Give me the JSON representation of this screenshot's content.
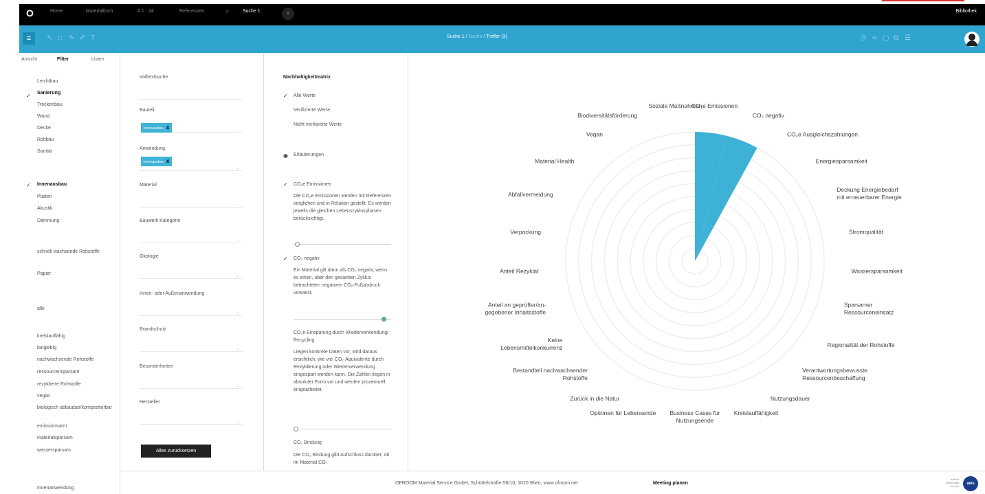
{
  "topbar": {
    "logo": "O",
    "tabs": [
      "Home",
      "Materialtisch",
      "# 1 - 24",
      "Referenzen",
      "Suche 1"
    ],
    "library": "Bibliothek",
    "close": "×",
    "search_icon": "search-icon"
  },
  "toolbar": {
    "menu": "≡",
    "crumb_a": "Suche 1 / ",
    "crumb_b": "Suche",
    "crumb_c": " / Treffer (3)"
  },
  "filter": {
    "segments": [
      "Ansicht",
      "Filter",
      "Listen"
    ],
    "groups": [
      "Leichtbau",
      "Sanierung",
      "Trockenbau",
      "Wand",
      "Decke",
      "Rohbau",
      "Sanitär",
      "Innenausbau",
      "Platten",
      "Akustik",
      "Dämmung",
      "schnell wachsende Rohstoffe",
      "Papier",
      "alle",
      "kreislauffähig",
      "langlebig",
      "nachwachsende Rohstoffe",
      "ressourcensparsam",
      "rezyklierte Rohstoffe",
      "vegan",
      "biologisch abbaubar/kompostierbar",
      "emissionsarm",
      "materialsparsam",
      "wassersparsam",
      "Innenanwendung"
    ]
  },
  "search": {
    "fields": [
      "Volltextsuche",
      "Bauteil",
      "Anwendung",
      "Material",
      "Bauwerk Kategorie",
      "Ökologie",
      "Innen- oder Außenanwendung",
      "Brandschutz",
      "Besonderheiten",
      "Hersteller"
    ],
    "chip_bauteil": "Innenausbau",
    "chip_anwendung": "Innenausbau",
    "chip_x": "x",
    "reset": "Alles zurücksetzen"
  },
  "matrix": {
    "title": "Nachhaltigkeitmatrix",
    "opt1": "Alle Werte",
    "opt2": "Verifizierte Werte",
    "opt3": "Nicht verifizierte Werte",
    "opt4": "Erläuterungen",
    "s1_title": "CO₂e Emissionen",
    "s1_desc": "Die CO₂e Emissionen werden mit Referenzen verglichen und in Relation gestellt. Es werden jeweils die gleichen Lebenszyklusphasen berücksichtigt.",
    "s2_title": "CO₂ negativ",
    "s2_desc": "Ein Material gilt dann als CO₂ negativ, wenn es einen, über den gesamten Zyklus betrachteten negativen CO₂-Fußabdruck vorweist.",
    "s3_title": "CO₂e Einsparung durch Wiederverwendung/ Recycling",
    "s3_desc": "Liegen konkrete Daten vor, wird daraus ersichtlich, wie viel CO₂ Äquivalente durch Rezyklierung oder Wiederverwendung eingespart werden kann. Die Zahlen liegen in absoluter Form vor und werden prozentuell eingearbeitet.",
    "s4_title": "CO₂ Bindung",
    "s4_desc": "Die CO₂ Bindung gibt Aufschluss darüber, ob im Material CO₂"
  },
  "chart_data": {
    "type": "radar",
    "rings": 10,
    "highlight_color": "#3eb1d6",
    "categories": [
      "CO₂e Emissionen",
      "CO₂ negativ",
      "CO₂e Ausgleichszahlungen",
      "Energiesparsamkeit",
      "Deckung Energiebedarf mit erneuerbarer Energie",
      "Stromqualität",
      "Wassersparsamkeit",
      "Sparsamer Ressourceneinsatz",
      "Regionalität der Rohstoffe",
      "Verantwortungsbewusste Ressourcenbeschaffung",
      "Nutzungsdauer",
      "Kreislauffähigkeit",
      "Business Cases für Nutzungsende",
      "Optionen für Lebensende",
      "Zurück in die Natur",
      "Bestandteil nachwachsender Rohstoffe",
      "Keine Lebensmittelkonkurrenz",
      "Anteil an geprüfter/an-gegebener Inhaltsstoffe",
      "Anteil Rezyklat",
      "Verpackung",
      "Abfallvermeidung",
      "Material Health",
      "Vegan",
      "Biodiversitätsförderung",
      "Soziale Maßnahmen"
    ],
    "values": [
      10,
      10,
      0,
      0,
      0,
      0,
      0,
      0,
      0,
      0,
      0,
      0,
      0,
      0,
      0,
      0,
      0,
      0,
      0,
      0,
      0,
      0,
      0,
      0,
      0
    ],
    "max": 10
  },
  "footer": {
    "address": "OFROOM Material Service GmbH, Schüttelstraße 56/10, 1020 Wien, www.ofroom.net",
    "meeting": "Meeting planen",
    "aws_text": "austria wirtschafts service",
    "aws_logo": "aws"
  }
}
